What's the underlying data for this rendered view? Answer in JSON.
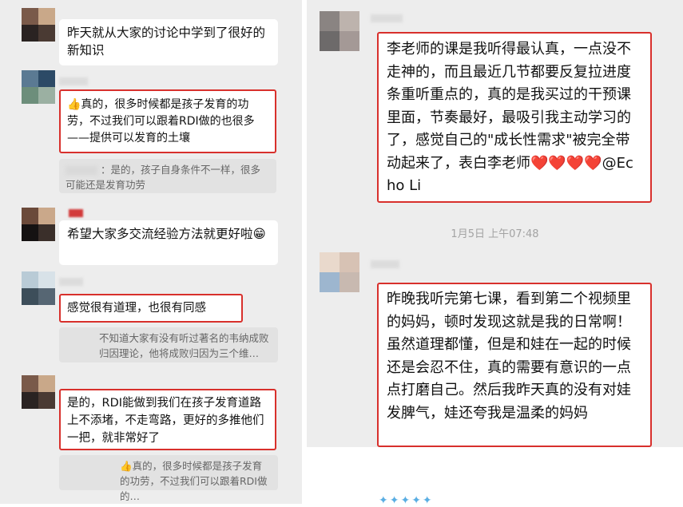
{
  "left_chat": {
    "messages": [
      {
        "text": "昨天就从大家的讨论中学到了很好的新知识"
      },
      {
        "text": "👍真的，很多时候都是孩子发育的功劳，不过我们可以跟着RDI做的也很多——提供可以发育的土壤"
      },
      {
        "quote": "：是的，孩子自身条件不一样，很多可能还是发育功劳"
      },
      {
        "text": "希望大家多交流经验方法就更好啦😁"
      },
      {
        "text": "感觉很有道理，也很有同感"
      },
      {
        "quote": "不知道大家有没有听过著名的韦纳成败归因理论，他将成败归因为三个维…"
      },
      {
        "text": "是的，RDI能做到我们在孩子发育道路上不添堵，不走弯路，更好的多推他们一把，就非常好了"
      },
      {
        "quote": "👍真的，很多时候都是孩子发育的功劳，不过我们可以跟着RDI做的…"
      }
    ]
  },
  "right_chat": {
    "message1": "李老师的课是我听得最认真，一点没不走神的，而且最近几节都要反复拉进度条重听重点的，真的是我买过的干预课里面，节奏最好，最吸引我主动学习的了，感觉自己的\"成长性需求\"被完全带动起来了，表白李老师❤️❤️❤️❤️@Echo Li",
    "timestamp": "1月5日 上午07:48",
    "message2": "昨晚我听完第七课，看到第二个视频里的妈妈，顿时发现这就是我的日常啊！虽然道理都懂，但是和娃在一起的时候还是会忍不住，真的需要有意识的一点点打磨自己。然后我昨天真的没有对娃发脾气，娃还夸我是温柔的妈妈",
    "stars": "✦✦✦✦✦"
  },
  "colors": {
    "highlight": "#d8302c",
    "chat_bg": "#ededed",
    "bubble": "#ffffff",
    "timestamp": "#a3a3a3"
  }
}
